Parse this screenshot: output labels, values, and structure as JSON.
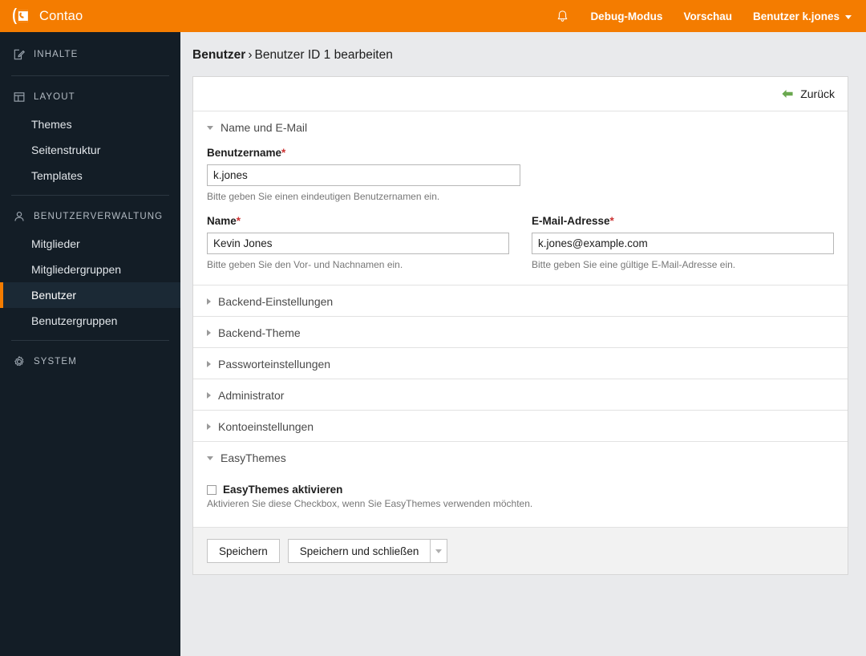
{
  "topbar": {
    "brand": "Contao",
    "logo_icon": "contao-logo-icon",
    "bell_icon": "bell-icon",
    "nav": [
      {
        "label": "Debug-Modus",
        "name": "debug-mode-link"
      },
      {
        "label": "Vorschau",
        "name": "preview-link"
      },
      {
        "label": "Benutzer k.jones",
        "name": "user-menu-link",
        "caret": true
      }
    ],
    "accent_color": "#f47c00"
  },
  "sidebar": {
    "background": "#131d26",
    "active_accent": "#f47c00",
    "sections": [
      {
        "label": "INHALTE",
        "icon": "edit-icon",
        "name": "sidebar-section-inhalte",
        "items": []
      },
      {
        "label": "LAYOUT",
        "icon": "layout-icon",
        "name": "sidebar-section-layout",
        "items": [
          {
            "label": "Themes",
            "name": "sidebar-item-themes",
            "active": false
          },
          {
            "label": "Seitenstruktur",
            "name": "sidebar-item-seitenstruktur",
            "active": false
          },
          {
            "label": "Templates",
            "name": "sidebar-item-templates",
            "active": false
          }
        ]
      },
      {
        "label": "BENUTZERVERWALTUNG",
        "icon": "user-icon",
        "name": "sidebar-section-benutzerverwaltung",
        "items": [
          {
            "label": "Mitglieder",
            "name": "sidebar-item-mitglieder",
            "active": false
          },
          {
            "label": "Mitgliedergruppen",
            "name": "sidebar-item-mitgliedergruppen",
            "active": false
          },
          {
            "label": "Benutzer",
            "name": "sidebar-item-benutzer",
            "active": true
          },
          {
            "label": "Benutzergruppen",
            "name": "sidebar-item-benutzergruppen",
            "active": false
          }
        ]
      },
      {
        "label": "SYSTEM",
        "icon": "gear-icon",
        "name": "sidebar-section-system",
        "items": []
      }
    ]
  },
  "breadcrumb": {
    "root": "Benutzer",
    "separator": "›",
    "current": "Benutzer ID 1 bearbeiten"
  },
  "panel": {
    "back_label": "Zurück",
    "back_icon": "arrow-left-icon",
    "back_icon_color": "#6aa84f"
  },
  "form": {
    "required_marker": "*",
    "fieldsets": [
      {
        "legend": "Name und E-Mail",
        "name": "fieldset-name-und-email",
        "expanded": true
      },
      {
        "legend": "Backend-Einstellungen",
        "name": "fieldset-backend-einstellungen",
        "expanded": false
      },
      {
        "legend": "Backend-Theme",
        "name": "fieldset-backend-theme",
        "expanded": false
      },
      {
        "legend": "Passworteinstellungen",
        "name": "fieldset-passworteinstellungen",
        "expanded": false
      },
      {
        "legend": "Administrator",
        "name": "fieldset-administrator",
        "expanded": false
      },
      {
        "legend": "Kontoeinstellungen",
        "name": "fieldset-kontoeinstellungen",
        "expanded": false
      },
      {
        "legend": "EasyThemes",
        "name": "fieldset-easythemes",
        "expanded": true
      }
    ],
    "username": {
      "label": "Benutzername",
      "value": "k.jones",
      "hint": "Bitte geben Sie einen eindeutigen Benutzernamen ein.",
      "required": true
    },
    "name": {
      "label": "Name",
      "value": "Kevin Jones",
      "hint": "Bitte geben Sie den Vor- und Nachnamen ein.",
      "required": true
    },
    "email": {
      "label": "E-Mail-Adresse",
      "value": "k.jones@example.com",
      "hint": "Bitte geben Sie eine gültige E-Mail-Adresse ein.",
      "required": true
    },
    "easythemes": {
      "checkbox_label": "EasyThemes aktivieren",
      "checked": false,
      "hint": "Aktivieren Sie diese Checkbox, wenn Sie EasyThemes verwenden möchten."
    }
  },
  "submit": {
    "save": "Speichern",
    "save_and_close": "Speichern und schließen",
    "dropdown_icon": "caret-down-icon"
  }
}
